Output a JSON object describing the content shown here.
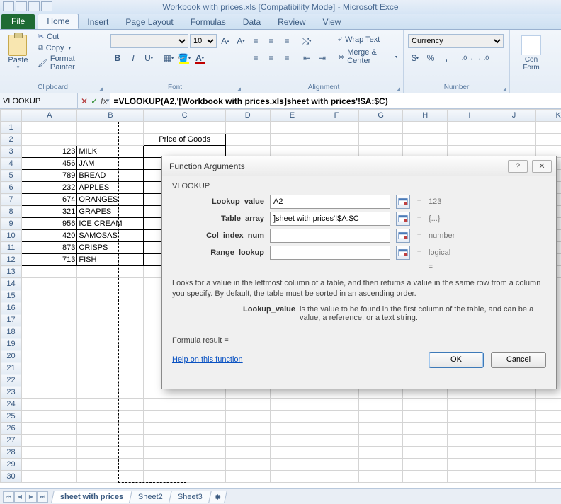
{
  "title": "Workbook with prices.xls  [Compatibility Mode]  -  Microsoft Exce",
  "tabs": {
    "file": "File",
    "home": "Home",
    "insert": "Insert",
    "page": "Page Layout",
    "formulas": "Formulas",
    "data": "Data",
    "review": "Review",
    "view": "View"
  },
  "clipboard": {
    "paste": "Paste",
    "cut": "Cut",
    "copy": "Copy",
    "fp": "Format Painter",
    "label": "Clipboard"
  },
  "font": {
    "size": "10",
    "label": "Font"
  },
  "alignment": {
    "wrap": "Wrap Text",
    "merge": "Merge & Center",
    "label": "Alignment"
  },
  "number": {
    "format": "Currency",
    "label": "Number"
  },
  "cond": {
    "l1": "Con",
    "l2": "Form"
  },
  "namebox": "VLOOKUP",
  "formula": "=VLOOKUP(A2,'[Workbook with prices.xls]sheet with prices'!$A:$C)",
  "cols": [
    "A",
    "B",
    "C",
    "D",
    "E",
    "F",
    "G",
    "H",
    "I",
    "J",
    "K"
  ],
  "header_c": "Price of Goods",
  "rows": [
    {
      "a": "123",
      "b": "MILK"
    },
    {
      "a": "456",
      "b": "JAM"
    },
    {
      "a": "789",
      "b": "BREAD"
    },
    {
      "a": "232",
      "b": "APPLES"
    },
    {
      "a": "674",
      "b": "ORANGES"
    },
    {
      "a": "321",
      "b": "GRAPES"
    },
    {
      "a": "956",
      "b": "ICE CREAM"
    },
    {
      "a": "420",
      "b": "SAMOSAS"
    },
    {
      "a": "873",
      "b": "CRISPS"
    },
    {
      "a": "713",
      "b": "FISH"
    }
  ],
  "sheets": {
    "s1": "sheet with prices",
    "s2": "Sheet2",
    "s3": "Sheet3"
  },
  "dialog": {
    "title": "Function Arguments",
    "fn": "VLOOKUP",
    "args": [
      {
        "label": "Lookup_value",
        "value": "A2",
        "result": "123"
      },
      {
        "label": "Table_array",
        "value": "]sheet with prices'!$A:$C",
        "result": "{...}"
      },
      {
        "label": "Col_index_num",
        "value": "",
        "result": "number"
      },
      {
        "label": "Range_lookup",
        "value": "",
        "result": "logical"
      }
    ],
    "desc": "Looks for a value in the leftmost column of a table, and then returns a value in the same row from a column you specify. By default, the table must be sorted in an ascending order.",
    "desc2_k": "Lookup_value",
    "desc2_v": "is the value to be found in the first column of the table, and can be a value, a reference, or a text string.",
    "formres": "Formula result =",
    "help": "Help on this function",
    "ok": "OK",
    "cancel": "Cancel"
  }
}
